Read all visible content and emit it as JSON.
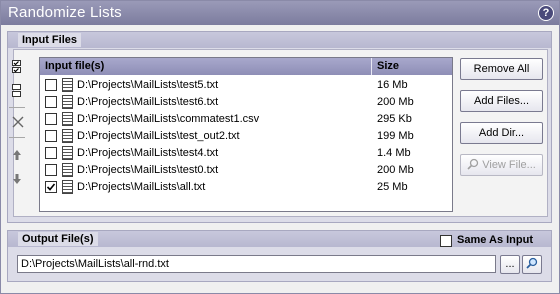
{
  "window": {
    "title": "Randomize Lists",
    "help_label": "?"
  },
  "input_panel": {
    "title": "Input Files",
    "columns": {
      "file": "Input file(s)",
      "size": "Size"
    },
    "rows": [
      {
        "path": "D:\\Projects\\MailLists\\test5.txt",
        "size": "16 Mb",
        "checked": false
      },
      {
        "path": "D:\\Projects\\MailLists\\test6.txt",
        "size": "200 Mb",
        "checked": false
      },
      {
        "path": "D:\\Projects\\MailLists\\commatest1.csv",
        "size": "295 Kb",
        "checked": false
      },
      {
        "path": "D:\\Projects\\MailLists\\test_out2.txt",
        "size": "199 Mb",
        "checked": false
      },
      {
        "path": "D:\\Projects\\MailLists\\test4.txt",
        "size": "1.4 Mb",
        "checked": false
      },
      {
        "path": "D:\\Projects\\MailLists\\test0.txt",
        "size": "200 Mb",
        "checked": false
      },
      {
        "path": "D:\\Projects\\MailLists\\all.txt",
        "size": "25 Mb",
        "checked": true
      }
    ],
    "buttons": {
      "remove_all": "Remove All",
      "add_files": "Add Files...",
      "add_dir": "Add Dir...",
      "view_file": "View File..."
    },
    "side_icons": [
      "check-all-icon",
      "uncheck-all-icon",
      "delete-icon",
      "move-up-icon",
      "move-down-icon"
    ]
  },
  "output_panel": {
    "title": "Output File(s)",
    "same_as_input_label": "Same As Input",
    "same_as_input_checked": false,
    "path": "D:\\Projects\\MailLists\\all-rnd.txt",
    "browse_label": "...",
    "colors": {
      "accent": "#8e8eb6",
      "panel": "#dcdce8"
    }
  }
}
